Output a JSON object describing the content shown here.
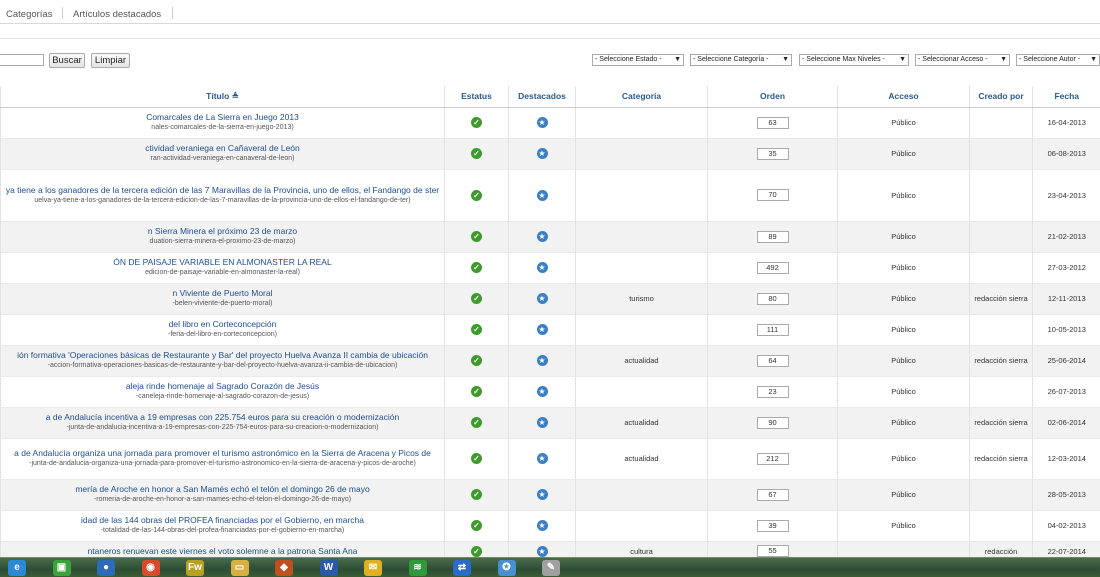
{
  "nav": {
    "tabs": [
      "Categorías",
      "Artículos destacados"
    ]
  },
  "toolbar": {
    "search_button": "Buscar",
    "clear_button": "Limpiar",
    "filters": [
      "- Seleccione Estado -",
      "- Seleccione Categoría -",
      "- Seleccione Max Niveles -",
      "- Seleccionar Acceso -",
      "- Seleccione Autor -"
    ]
  },
  "table": {
    "headers": {
      "title": "Título",
      "status": "Estatus",
      "featured": "Destacados",
      "category": "Categoría",
      "order": "Orden",
      "access": "Acceso",
      "created_by": "Creado por",
      "date": "Fecha"
    },
    "rows": [
      {
        "title": "Comarcales de La Sierra en Juego 2013",
        "alias": "nales-comarcales-de-la-sierra-en-juego-2013)",
        "category": "",
        "order": "63",
        "access": "Público",
        "author": "",
        "date": "16-04-2013"
      },
      {
        "title": "ctividad veraniega en Cañaveral de León",
        "alias": "ran-actividad-veraniega-en-canaveral-de-leon)",
        "category": "",
        "order": "35",
        "access": "Público",
        "author": "",
        "date": "06-08-2013"
      },
      {
        "title": "ya tiene a los ganadores de la tercera edición de las 7 Maravillas de la Provincia, uno de ellos, el Fandango de ster",
        "alias": "uelva-ya-tiene-a-los-ganadores-de-la-tercera-edicion-de-las-7-maravillas-de-la-provincia-uno-de-ellos-el-fandango-de-ter)",
        "category": "",
        "order": "70",
        "access": "Público",
        "author": "",
        "date": "23-04-2013"
      },
      {
        "title": "n Sierra Minera el próximo 23 de marzo",
        "alias": "duation-sierra-minera-el-proximo-23-de-marzo)",
        "category": "",
        "order": "89",
        "access": "Público",
        "author": "",
        "date": "21-02-2013"
      },
      {
        "title": "ÓN DE PAISAJE VARIABLE EN ALMONASTER LA REAL",
        "alias": "edicion-de-paisaje-variable-en-almonaster-la-real)",
        "category": "",
        "order": "492",
        "access": "Público",
        "author": "",
        "date": "27-03-2012"
      },
      {
        "title": "n Viviente de Puerto Moral",
        "alias": "-belen-viviente-de-puerto-moral)",
        "category": "turismo",
        "order": "80",
        "access": "Público",
        "author": "redacción sierra",
        "date": "12-11-2013"
      },
      {
        "title": "del libro en Corteconcepción",
        "alias": "-feria-del-libro-en-corteconcepcion)",
        "category": "",
        "order": "111",
        "access": "Público",
        "author": "",
        "date": "10-05-2013"
      },
      {
        "title": "ión formativa 'Operaciones básicas de Restaurante y Bar' del proyecto Huelva Avanza II cambia de ubicación",
        "alias": "-accion-formativa-operaciones-basicas-de-restaurante-y-bar-del-proyecto-huelva-avanza-ii-cambia-de-ubicacion)",
        "category": "actualidad",
        "order": "64",
        "access": "Público",
        "author": "redacción sierra",
        "date": "25-06-2014"
      },
      {
        "title": "aleja rinde homenaje al Sagrado Corazón de Jesús",
        "alias": "-caneleja-rinde-homenaje-al-sagrado-corazon-de-jesus)",
        "category": "",
        "order": "23",
        "access": "Público",
        "author": "",
        "date": "26-07-2013"
      },
      {
        "title": "a de Andalucía incentiva a 19 empresas con 225.754 euros para su creación o modernización",
        "alias": "-junta-de-andalucia-incentiva-a-19-empresas-con-225-754-euros-para-su-creacion-o-modernizacion)",
        "category": "actualidad",
        "order": "90",
        "access": "Público",
        "author": "redacción sierra",
        "date": "02-06-2014"
      },
      {
        "title": "a de Andalucía organiza una jornada para promover el turismo astronómico en la Sierra de Aracena y Picos de",
        "alias": "-junta-de-andalucia-organiza-una-jornada-para-promover-el-turismo-astronomico-en-la-sierra-de-aracena-y-picos-de-aroche)",
        "category": "actualidad",
        "order": "212",
        "access": "Público",
        "author": "redacción sierra",
        "date": "12-03-2014"
      },
      {
        "title": "mería de Aroche en honor a San Mamés echó el telón el domingo 26 de mayo",
        "alias": "-romeria-de-aroche-en-honor-a-san-mames-echo-el-telon-el-domingo-26-de-mayo)",
        "category": "",
        "order": "67",
        "access": "Público",
        "author": "",
        "date": "28-05-2013"
      },
      {
        "title": "idad de las 144 obras del PROFEA financiadas por el Gobierno, en marcha",
        "alias": "-totalidad-de-las-144-obras-del-profea-financiadas-por-el-gobierno-en-marcha)",
        "category": "",
        "order": "39",
        "access": "Público",
        "author": "",
        "date": "04-02-2013"
      },
      {
        "title": "ntaneros renuevan este viernes el voto solemne a la patrona Santa Ana",
        "alias": "",
        "category": "cultura",
        "order": "55",
        "access": "",
        "author": "redacción",
        "date": "22-07-2014"
      }
    ]
  },
  "taskbar": {
    "icons": [
      "ie-icon",
      "store-icon",
      "app-icon",
      "chrome-icon",
      "fireworks-icon",
      "explorer-icon",
      "dog-icon",
      "word-icon",
      "mail-icon",
      "spotify-icon",
      "teamviewer-icon",
      "safari-icon",
      "tool-icon"
    ],
    "glyphs": [
      "e",
      "▣",
      "●",
      "◉",
      "Fw",
      "▭",
      "◆",
      "W",
      "✉",
      "≋",
      "⇄",
      "✪",
      "✎"
    ],
    "colors": [
      "#2a8ad8",
      "#3ca33c",
      "#2b6bb8",
      "#d84a2a",
      "#b8a020",
      "#d8b040",
      "#c05020",
      "#2a5aa8",
      "#e0b020",
      "#2f9a3a",
      "#2a6ac8",
      "#4a90d0",
      "#a0a0a0"
    ]
  },
  "colors": {
    "link": "#1f4e8c",
    "header": "#2a5a8a",
    "ok": "#3d9a2b",
    "star": "#3a7fc4"
  }
}
